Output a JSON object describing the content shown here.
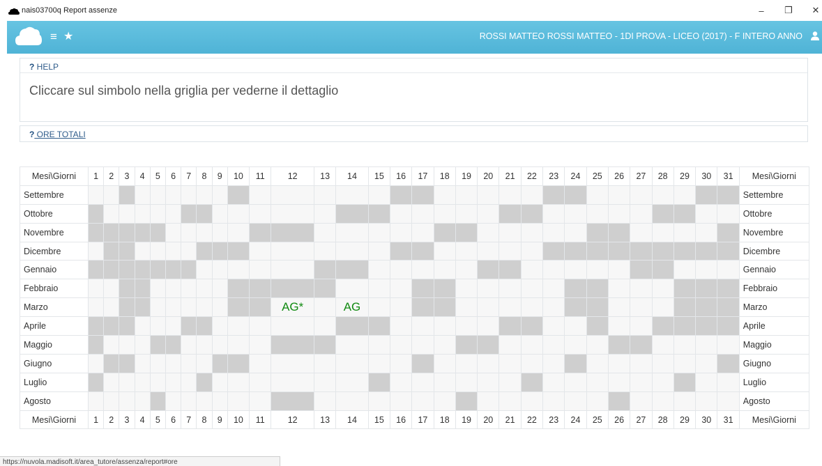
{
  "window": {
    "title": "nais03700q Report assenze",
    "minimize": "–",
    "restore": "❐",
    "close": "✕"
  },
  "appbar": {
    "menu_glyph": "≡",
    "star_glyph": "★",
    "user_text": "ROSSI MATTEO  ROSSI MATTEO - 1DI PROVA - LICEO (2017) - F  INTERO ANNO"
  },
  "help": {
    "q": "?",
    "label": " HELP",
    "text": "Cliccare sul simbolo nella griglia per vederne il dettaglio"
  },
  "ore": {
    "q": "?",
    "label": " ORE TOTALI"
  },
  "grid": {
    "corner_label": "Mesi\\Giorni",
    "days": [
      "1",
      "2",
      "3",
      "4",
      "5",
      "6",
      "7",
      "8",
      "9",
      "10",
      "11",
      "12",
      "13",
      "14",
      "15",
      "16",
      "17",
      "18",
      "19",
      "20",
      "21",
      "22",
      "23",
      "24",
      "25",
      "26",
      "27",
      "28",
      "29",
      "30",
      "31"
    ],
    "months": [
      {
        "name": "Settembre",
        "gray": [
          3,
          10,
          16,
          17,
          23,
          24,
          30,
          31
        ],
        "events": {}
      },
      {
        "name": "Ottobre",
        "gray": [
          1,
          7,
          8,
          14,
          15,
          21,
          22,
          28,
          29
        ],
        "events": {}
      },
      {
        "name": "Novembre",
        "gray": [
          1,
          2,
          3,
          4,
          5,
          11,
          12,
          18,
          19,
          25,
          26,
          31
        ],
        "events": {}
      },
      {
        "name": "Dicembre",
        "gray": [
          2,
          3,
          8,
          9,
          10,
          16,
          17,
          23,
          24,
          25,
          26,
          27,
          28,
          29,
          30,
          31
        ],
        "events": {}
      },
      {
        "name": "Gennaio",
        "gray": [
          1,
          2,
          3,
          4,
          5,
          6,
          7,
          13,
          14,
          20,
          21,
          27,
          28
        ],
        "events": {}
      },
      {
        "name": "Febbraio",
        "gray": [
          3,
          4,
          10,
          11,
          12,
          13,
          17,
          18,
          24,
          25,
          29,
          30,
          31
        ],
        "events": {}
      },
      {
        "name": "Marzo",
        "gray": [
          3,
          4,
          10,
          11,
          17,
          18,
          24,
          25,
          29,
          30,
          31
        ],
        "events": {
          "12": "AG*",
          "14": "AG"
        }
      },
      {
        "name": "Aprile",
        "gray": [
          1,
          2,
          3,
          7,
          8,
          14,
          15,
          21,
          22,
          25,
          28,
          29,
          30,
          31
        ],
        "events": {}
      },
      {
        "name": "Maggio",
        "gray": [
          1,
          5,
          6,
          12,
          13,
          19,
          20,
          26,
          27
        ],
        "events": {}
      },
      {
        "name": "Giugno",
        "gray": [
          2,
          3,
          9,
          10,
          17,
          24,
          31
        ],
        "events": {}
      },
      {
        "name": "Luglio",
        "gray": [
          1,
          8,
          15,
          22,
          29
        ],
        "events": {}
      },
      {
        "name": "Agosto",
        "gray": [
          5,
          12,
          19,
          26
        ],
        "events": {}
      }
    ]
  },
  "status_url": "https://nuvola.madisoft.it/area_tutore/assenza/report#ore",
  "colors": {
    "appbar": "#5bc0de",
    "holiday": "#cfcfcf",
    "event": "#118a11"
  }
}
